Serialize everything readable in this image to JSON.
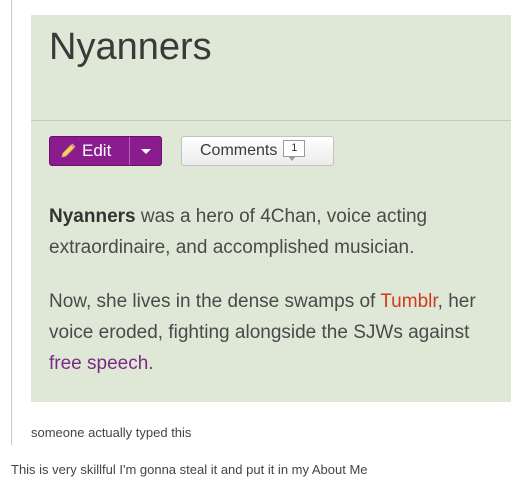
{
  "wiki": {
    "title": "Nyanners",
    "edit_label": "Edit",
    "comments_label": "Comments",
    "comments_count": "1",
    "paragraph1": {
      "bold": "Nyanners",
      "rest": " was a hero of 4Chan, voice acting extraordinaire, and accomplished musician."
    },
    "paragraph2": {
      "before": "Now, she lives in the dense swamps of ",
      "link1": "Tumblr",
      "middle": ", her voice eroded, fighting alongside the SJWs against ",
      "link2": "free speech",
      "after": "."
    },
    "colors": {
      "box_bg": "#dfe8d6",
      "edit_button": "#8a1c8e",
      "tumblr_link": "#d13a1a",
      "speech_link": "#7b2a85"
    }
  },
  "post": {
    "caption": "someone actually typed this",
    "reply": "This is very skillful I'm gonna steal it and put it in my About Me"
  },
  "icons": {
    "edit": "pencil-icon",
    "dropdown": "caret-down-icon"
  }
}
